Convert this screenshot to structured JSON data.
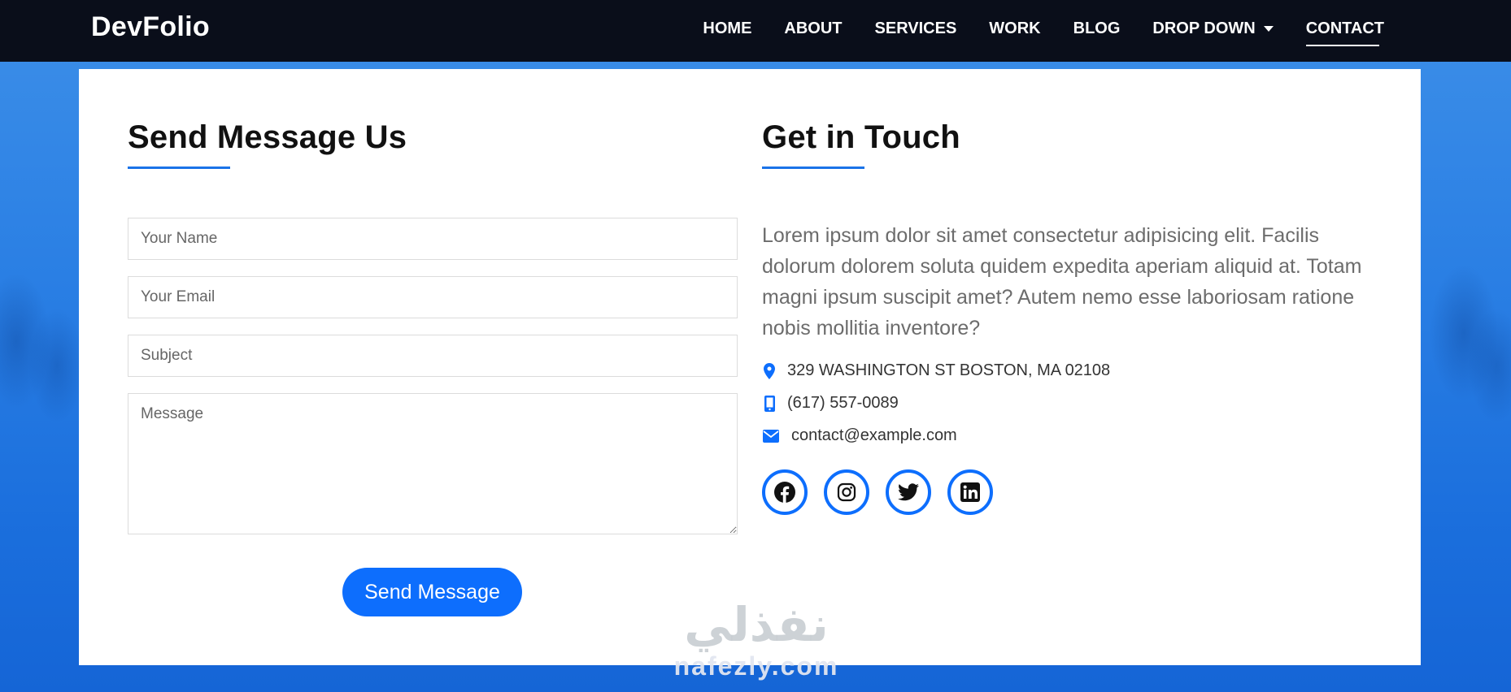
{
  "brand": "DevFolio",
  "nav": {
    "items": [
      {
        "label": "HOME"
      },
      {
        "label": "ABOUT"
      },
      {
        "label": "SERVICES"
      },
      {
        "label": "WORK"
      },
      {
        "label": "BLOG"
      },
      {
        "label": "DROP DOWN"
      },
      {
        "label": "CONTACT"
      }
    ],
    "active": "CONTACT"
  },
  "form": {
    "title": "Send Message Us",
    "name_placeholder": "Your Name",
    "email_placeholder": "Your Email",
    "subject_placeholder": "Subject",
    "message_placeholder": "Message",
    "submit_label": "Send Message"
  },
  "info": {
    "title": "Get in Touch",
    "text": "Lorem ipsum dolor sit amet consectetur adipisicing elit. Facilis dolorum dolorem soluta quidem expedita aperiam aliquid at. Totam magni ipsum suscipit amet? Autem nemo esse laboriosam ratione nobis mollitia inventore?",
    "address": "329 WASHINGTON ST BOSTON, MA 02108",
    "phone": "(617) 557-0089",
    "email": "contact@example.com",
    "socials": [
      "facebook-icon",
      "instagram-icon",
      "twitter-icon",
      "linkedin-icon"
    ]
  },
  "watermark": {
    "arabic": "نفذلي",
    "latin": "nafezly.com"
  },
  "colors": {
    "accent": "#0d6efd",
    "navbar": "#0a0e1a",
    "background": "#2a7fe4"
  }
}
